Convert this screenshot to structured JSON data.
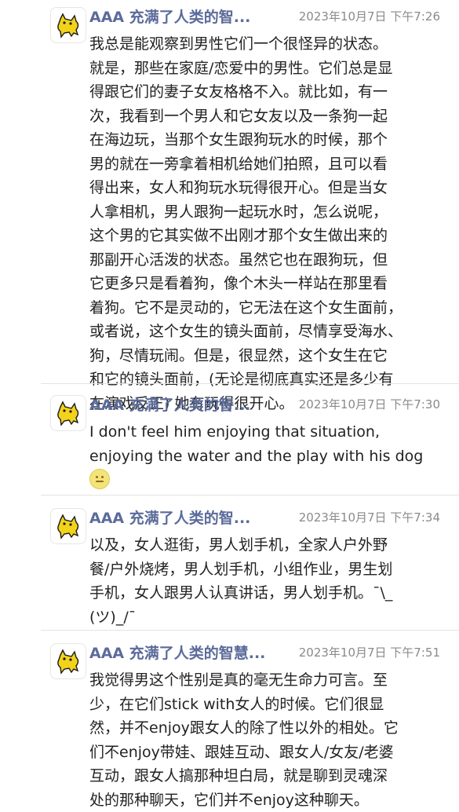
{
  "messages": [
    {
      "name": "AAA 充满了人类的智...",
      "time": "2023年10月7日 下午7:26",
      "text": "我总是能观察到男性它们一个很怪异的状态。\n就是，那些在家庭/恋爱中的男性。它们总是显\n得跟它们的妻子女友格格不入。就比如，有一\n次，我看到一个男人和它女友以及一条狗一起\n在海边玩，当那个女生跟狗玩水的时候，那个\n男的就在一旁拿着相机给她们拍照，且可以看\n得出来，女人和狗玩水玩得很开心。但是当女\n人拿相机，男人跟狗一起玩水时，怎么说呢，\n这个男的它其实做不出刚才那个女生做出来的\n那副开心活泼的状态。虽然它也在跟狗玩，但\n它更多只是看着狗，像个木头一样站在那里看\n着狗。它不是灵动的，它无法在这个女生面前，\n或者说，这个女生的镜头面前，尽情享受海水、\n狗，尽情玩闹。但是，很显然，这个女生在它\n和它的镜头面前，(无论是彻底真实还是多少有\n在演戏反正) 她有玩得很开心。"
    },
    {
      "name": "AAA 充满了人类的智...",
      "time": "2023年10月7日 下午7:30",
      "text": "I don't feel him enjoying that situation,\nenjoying the water and the play with his dog",
      "emoji": "neutral-face-emoji"
    },
    {
      "name": "AAA 充满了人类的智...",
      "time": "2023年10月7日 下午7:34",
      "text": "以及，女人逛街，男人划手机，全家人户外野\n餐/户外烧烤，男人划手机，小组作业，男生划\n手机，女人跟男人认真讲话，男人划手机。¯\\_\n(ツ)_/¯"
    },
    {
      "name": "AAA 充满了人类的智慧...",
      "time": "2023年10月7日 下午7:51",
      "text": "我觉得男这个性别是真的毫无生命力可言。至\n少，在它们stick with女人的时候。它们很显\n然，并不enjoy跟女人的除了性以外的相处。它\n们不enjoy带娃、跟娃互动、跟女人/女友/老婆\n互动，跟女人搞那种坦白局，就是聊到灵魂深\n处的那种聊天，它们并不enjoy这种聊天。"
    }
  ],
  "avatar_icon": "yellow-cat-icon"
}
